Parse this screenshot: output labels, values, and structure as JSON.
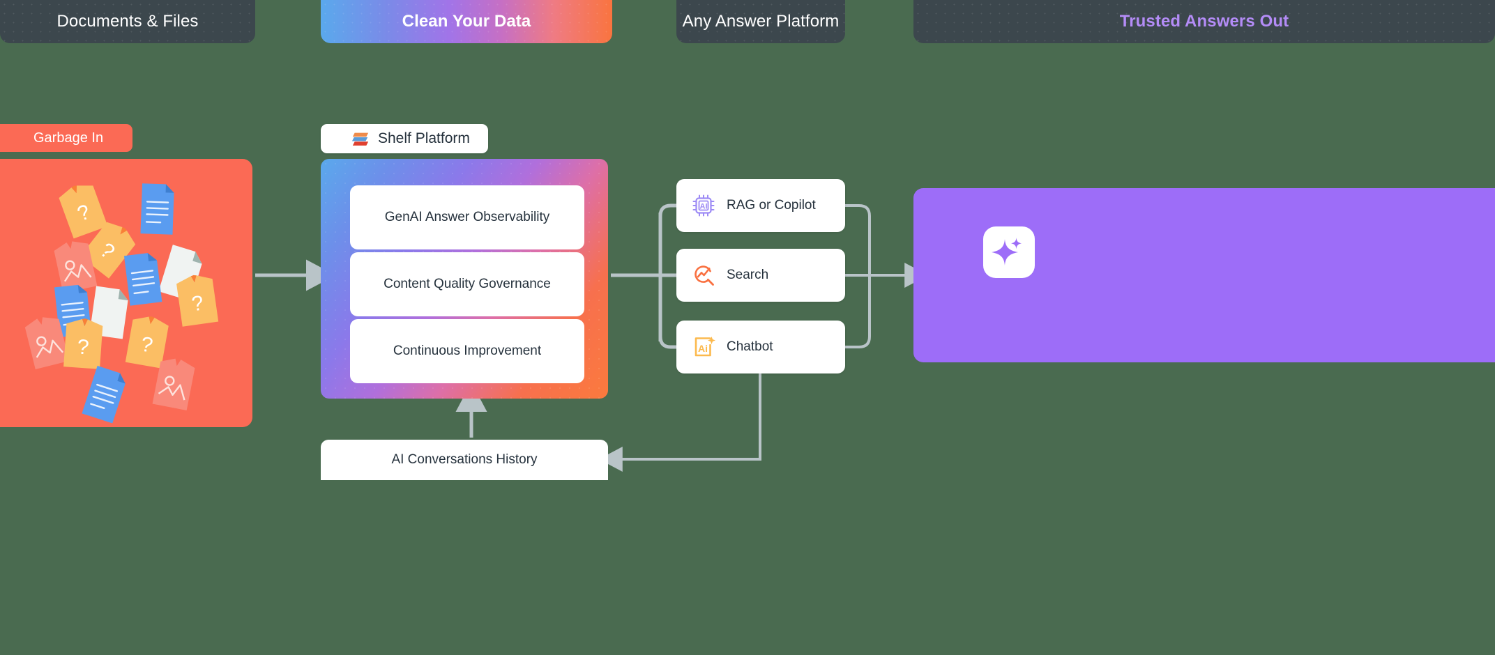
{
  "background_color": "#4a6b50",
  "banners": [
    {
      "id": "documents-files",
      "label": "Documents & Files",
      "style": "dark",
      "text_color": "#ffffff"
    },
    {
      "id": "clean-your-data",
      "label": "Clean Your Data",
      "style": "gradient",
      "text_color": "#ffffff"
    },
    {
      "id": "any-answer-platform",
      "label": "Any Answer Platform",
      "style": "dark",
      "text_color": "#ffffff"
    },
    {
      "id": "trusted-answers-out",
      "label": "Trusted Answers Out",
      "style": "dark",
      "text_color": "#b48cf7"
    }
  ],
  "input_stage": {
    "tag_label": "Garbage In",
    "tag_color": "#fb6a55",
    "box_color": "#fb6a55",
    "illustration": "scattered-documents"
  },
  "platform_stage": {
    "chip_label": "Shelf Platform",
    "logo_name": "shelf-logo",
    "logo_colors": [
      "#ef8b4a",
      "#5a9bd8",
      "#e0402f"
    ],
    "cards": [
      {
        "label": "GenAI Answer Observability"
      },
      {
        "label": "Content Quality Governance"
      },
      {
        "label": "Continuous  Improvement"
      }
    ]
  },
  "channels": [
    {
      "label": "RAG or Copilot",
      "icon": "ai-chip-icon",
      "icon_color": "#9d8bf5"
    },
    {
      "label": "Search",
      "icon": "search-analytics-icon",
      "icon_color": "#f97040"
    },
    {
      "label": "Chatbot",
      "icon": "ai-sparkle-frame-icon",
      "icon_color": "#fcb94d"
    }
  ],
  "output_stage": {
    "box_color": "#9d6df8",
    "badge_icon": "sparkle-icon",
    "badge_bg": "#ffffff"
  },
  "feedback": {
    "label": "AI Conversations History"
  },
  "connector_color": "#b9c4c8"
}
